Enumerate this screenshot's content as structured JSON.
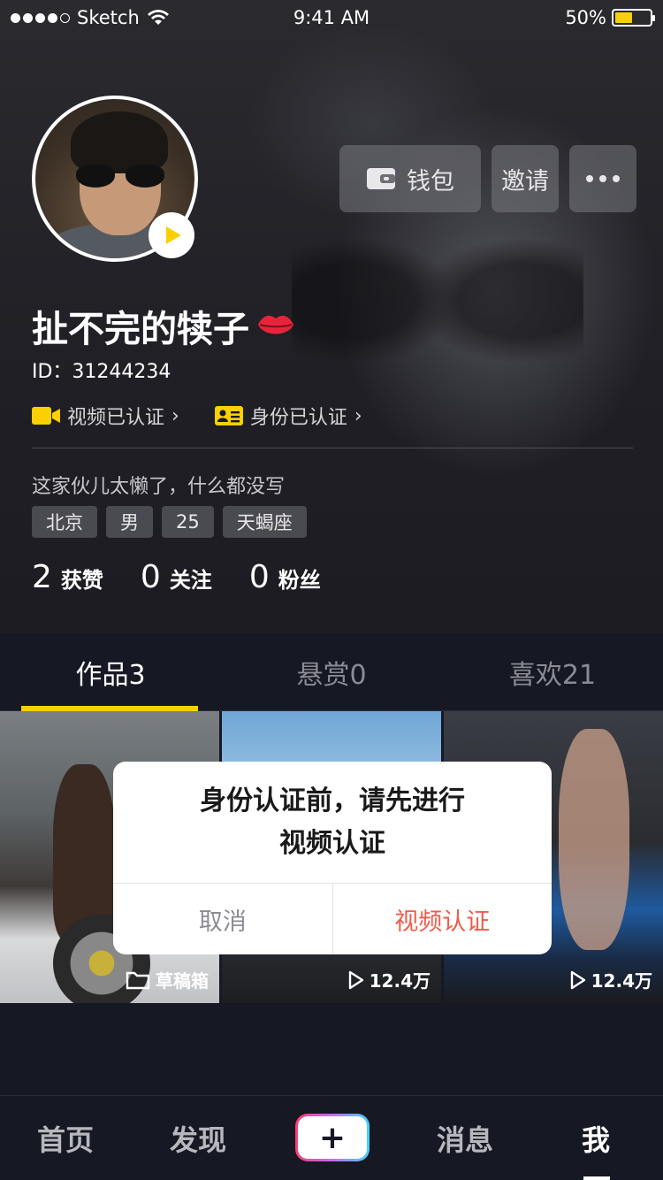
{
  "status_bar": {
    "carrier": "Sketch",
    "time": "9:41 AM",
    "battery_percent": "50%",
    "battery_level": 0.5
  },
  "profile": {
    "nickname": "扯不完的犊子",
    "id_text": "ID：31244234",
    "video_verified": "视频已认证",
    "identity_verified": "身份已认证",
    "bio": "这家伙儿太懒了，什么都没写",
    "tags": [
      "北京",
      "男",
      "25",
      "天蝎座"
    ],
    "stats": [
      {
        "num": "2",
        "label": "获赞"
      },
      {
        "num": "0",
        "label": "关注"
      },
      {
        "num": "0",
        "label": "粉丝"
      }
    ]
  },
  "actions": {
    "wallet": "钱包",
    "invite": "邀请"
  },
  "tabs": [
    {
      "label": "作品3",
      "active": true
    },
    {
      "label": "悬赏0",
      "active": false
    },
    {
      "label": "喜欢21",
      "active": false
    }
  ],
  "grid": [
    {
      "caption": "草稿箱",
      "icon": "folder-icon"
    },
    {
      "caption": "12.4万",
      "icon": "play-icon"
    },
    {
      "caption": "12.4万",
      "icon": "play-icon"
    }
  ],
  "dialog": {
    "line1": "身份认证前，请先进行",
    "line2": "视频认证",
    "cancel": "取消",
    "confirm": "视频认证",
    "confirm_color": "#f25a4a"
  },
  "bottom_nav": {
    "home": "首页",
    "discover": "发现",
    "plus": "+",
    "messages": "消息",
    "me": "我"
  },
  "colors": {
    "accent": "#fcd000",
    "background": "#161823"
  }
}
